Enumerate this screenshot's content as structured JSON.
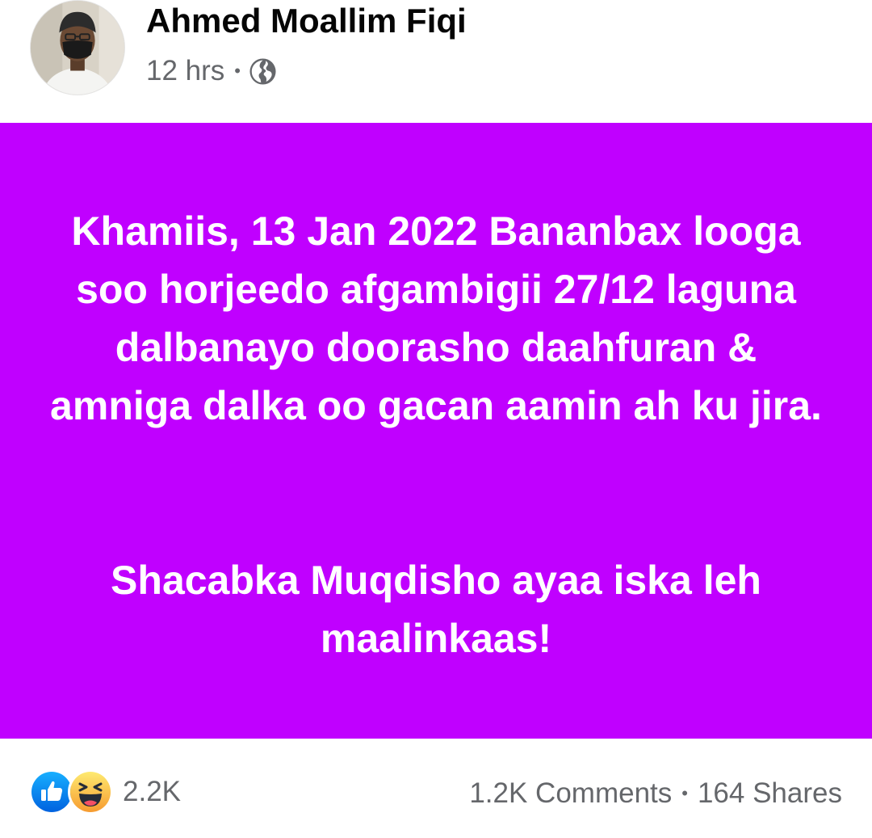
{
  "post": {
    "author": "Ahmed Moallim Fiqi",
    "time": "12 hrs",
    "separator": "•",
    "privacy_icon": "globe-icon",
    "background_color": "#c000ff",
    "text_color": "#ffffff",
    "paragraphs": [
      "Khamiis, 13 Jan 2022 Bananbax looga soo horjeedo afgambigii 27/12 laguna dalbanayo doorasho daahfuran & amniga dalka oo gacan aamin ah ku jira.",
      "Shacabka Muqdisho ayaa iska leh maalinkaas!"
    ]
  },
  "footer": {
    "reaction_icons": [
      "like-icon",
      "haha-icon"
    ],
    "reaction_count": "2.2K",
    "comments": "1.2K Comments",
    "separator": "•",
    "shares": "164 Shares"
  }
}
